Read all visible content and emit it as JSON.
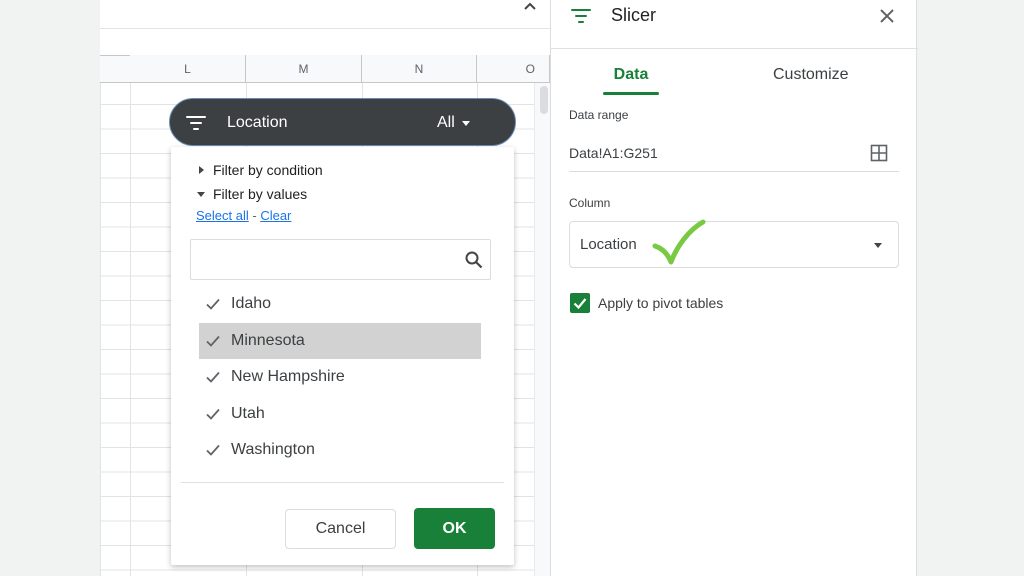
{
  "colors": {
    "accent": "#188038",
    "slicer_bg": "#3c4043",
    "link": "#1a73e8",
    "selected_row": "#d2d2d2"
  },
  "sheet": {
    "columns": [
      "L",
      "M",
      "N",
      "O"
    ]
  },
  "slicer": {
    "column_label": "Location",
    "current_value": "All"
  },
  "filter_menu": {
    "filter_by_condition": "Filter by condition",
    "filter_by_values": "Filter by values",
    "select_all": "Select all",
    "separator": " - ",
    "clear": "Clear",
    "search_placeholder": "",
    "values": [
      {
        "label": "Idaho",
        "checked": true
      },
      {
        "label": "Minnesota",
        "checked": true,
        "highlighted": true
      },
      {
        "label": "New Hampshire",
        "checked": true
      },
      {
        "label": "Utah",
        "checked": true
      },
      {
        "label": "Washington",
        "checked": true
      }
    ],
    "cancel_label": "Cancel",
    "ok_label": "OK"
  },
  "side_panel": {
    "title": "Slicer",
    "tabs": [
      "Data",
      "Customize"
    ],
    "active_tab": "Data",
    "data_range_label": "Data range",
    "data_range_value": "Data!A1:G251",
    "column_label": "Column",
    "column_value": "Location",
    "apply_pivot_label": "Apply to pivot tables",
    "apply_pivot_checked": true
  },
  "icons": [
    "filter-icon",
    "chevron-up-icon",
    "search-icon",
    "check-icon",
    "close-icon",
    "grid-icon",
    "checkbox-icon"
  ]
}
